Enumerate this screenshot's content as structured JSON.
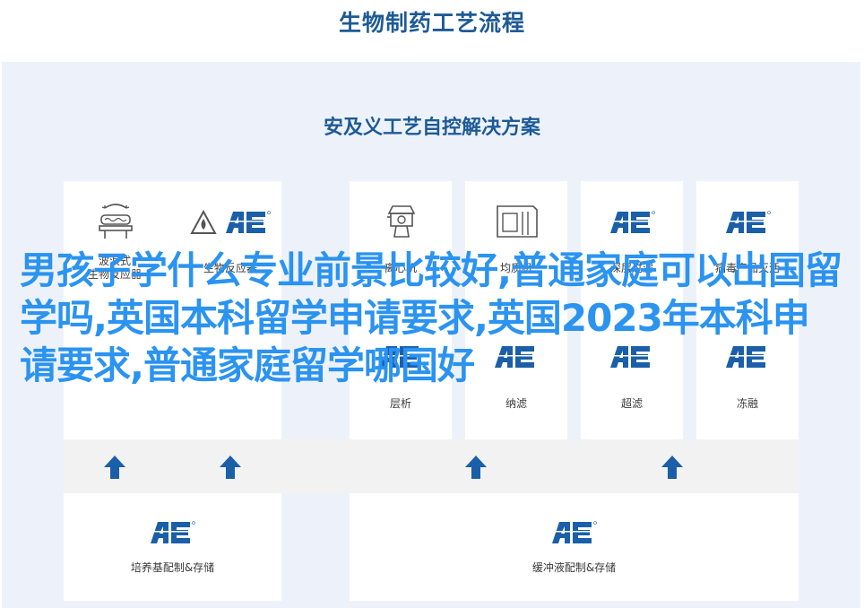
{
  "header": {
    "title": "生物制药工艺流程"
  },
  "panel": {
    "title": "安及义工艺自控解决方案"
  },
  "colors": {
    "accent": "#1d5a96",
    "panel_bg": "#edf2fa",
    "overlay_text": "#2b93f0",
    "logo": "#1a5fa8"
  },
  "top_cards": [
    {
      "label_line1": "波浪式",
      "label_line2": "生物反应器",
      "icon": "wave-bioreactor-icon"
    },
    {
      "label_line1": "生物反应器",
      "label_line2": "",
      "icon": "ae-logo-icon"
    },
    {
      "label_line1": "离心机",
      "label_line2": "",
      "icon": "centrifuge-icon"
    },
    {
      "label_line1": "均质机",
      "label_line2": "",
      "icon": "homogenizer-icon"
    },
    {
      "label_line1": "深层过滤",
      "label_line2": "",
      "icon": "ae-logo-icon"
    },
    {
      "label_line1": "病毒产品灭活",
      "label_line2": "",
      "icon": "ae-logo-icon"
    }
  ],
  "lower_cards": [
    {
      "label": "层析",
      "icon": "ae-logo-icon"
    },
    {
      "label": "纳滤",
      "icon": "ae-logo-icon"
    },
    {
      "label": "超滤",
      "icon": "ae-logo-icon"
    },
    {
      "label": "冻融",
      "icon": "ae-logo-icon"
    }
  ],
  "bottom_cards": [
    {
      "label": "培养基配制&存储",
      "icon": "ae-logo-icon"
    },
    {
      "label": "缓冲液配制&存储",
      "icon": "ae-logo-icon"
    }
  ],
  "overlay_text": "男孩子学什么专业前景比较好,普通家庭可以出国留学吗,英国本科留学申请要求,英国2023年本科申请要求,普通家庭留学哪国好"
}
